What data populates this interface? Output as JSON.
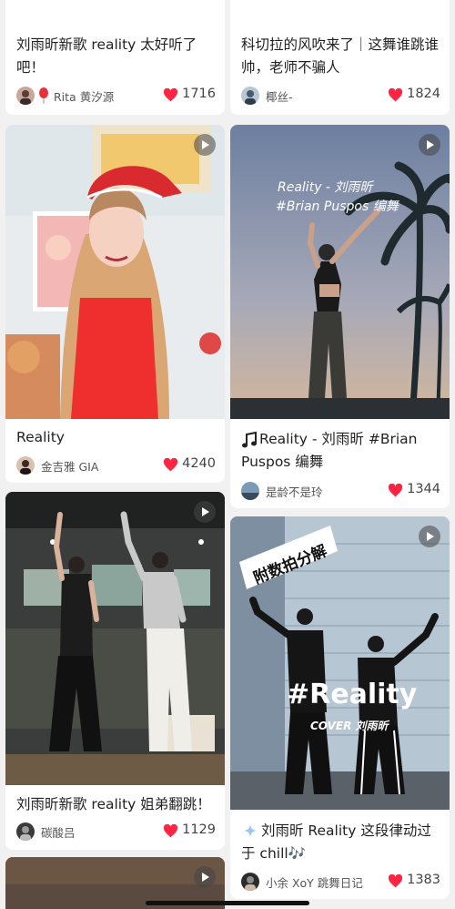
{
  "feed": {
    "cards": [
      {
        "title": "刘雨昕新歌 reality 太好听了吧！",
        "author": "Rita 黄汐源",
        "author_badge": "balloon-icon",
        "likes": "1716"
      },
      {
        "title": "科切拉的风吹来了｜这舞谁跳谁帅，老师不骗人",
        "author": "椰丝-",
        "likes": "1824"
      },
      {
        "title": "Reality",
        "author": "金吉雅 GIA",
        "likes": "4240",
        "has_video": true
      },
      {
        "title": "Reality - 刘雨昕 #Brian Puspos 编舞",
        "title_icon": "music-note-icon",
        "author": "是龄不是玲",
        "likes": "1344",
        "has_video": true,
        "overlay_text": [
          "Reality - 刘雨昕",
          "#Brian Puspos 编舞"
        ]
      },
      {
        "title": "刘雨昕新歌 reality 姐弟翻跳！",
        "author": "碳酸吕",
        "likes": "1129",
        "has_video": true
      },
      {
        "title": "刘雨昕 Reality 这段律动过于 chill",
        "title_icon": "sparkle-icon",
        "title_suffix": "🎶",
        "author": "小余 XoY 跳舞日记",
        "likes": "1383",
        "has_video": true,
        "overlay_text": [
          "附数拍分解",
          "#Reality",
          "COVER 刘雨昕"
        ]
      },
      {
        "has_video": true
      }
    ]
  },
  "colors": {
    "heart": "#ff2442",
    "background": "#f1f1f1",
    "card": "#ffffff"
  }
}
